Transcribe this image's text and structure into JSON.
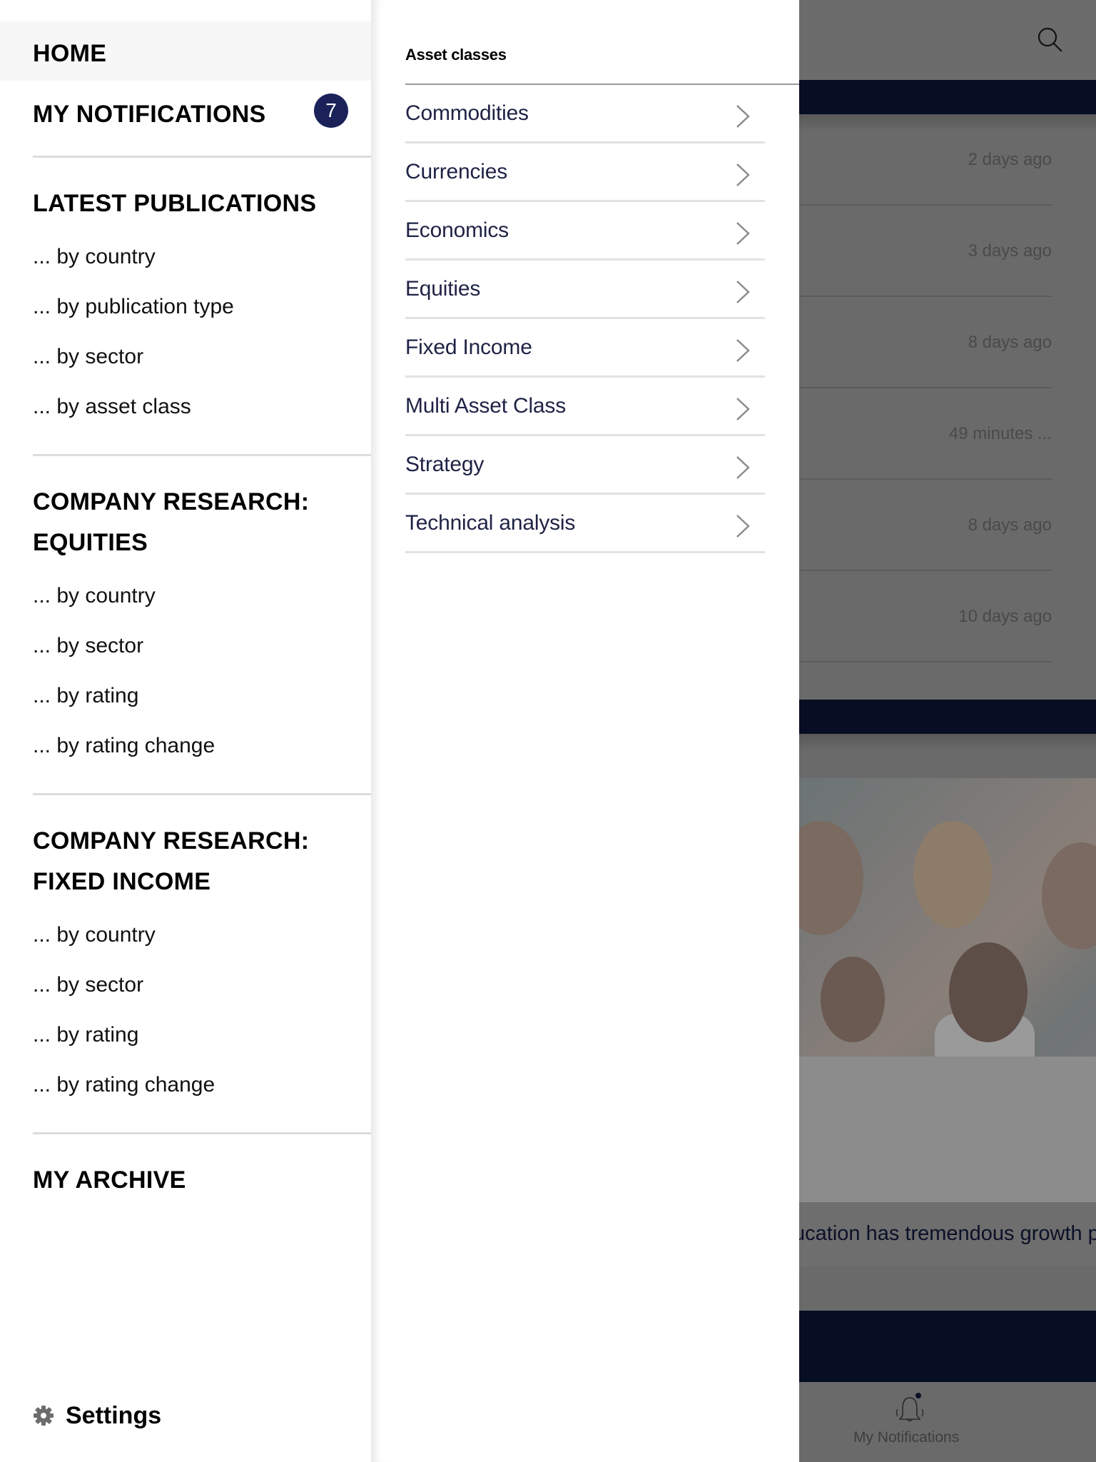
{
  "left_menu": {
    "home": "HOME",
    "notifications": {
      "label": "MY NOTIFICATIONS",
      "count": "7"
    },
    "sections": [
      {
        "title_lines": [
          "LATEST PUBLICATIONS"
        ],
        "items": [
          "... by country",
          "... by publication type",
          "... by sector",
          "... by asset class"
        ]
      },
      {
        "title_lines": [
          "COMPANY RESEARCH:",
          "EQUITIES"
        ],
        "items": [
          "... by country",
          "... by sector",
          "... by rating",
          "... by rating change"
        ]
      },
      {
        "title_lines": [
          "COMPANY RESEARCH:",
          "FIXED INCOME"
        ],
        "items": [
          "... by country",
          "... by sector",
          "... by rating",
          "... by rating change"
        ]
      }
    ],
    "archive": "MY ARCHIVE",
    "settings": "Settings"
  },
  "submenu": {
    "title": "Asset classes",
    "items": [
      "Commodities",
      "Currencies",
      "Economics",
      "Equities",
      "Fixed Income",
      "Multi Asset Class",
      "Strategy",
      "Technical analysis"
    ]
  },
  "background": {
    "timestamps": [
      "2 days ago",
      "3 days ago",
      "8 days ago",
      "49 minutes ...",
      "8 days ago",
      "10 days ago"
    ],
    "caption": "ucation has tremendous growth pot",
    "bottom_nav_label": "My Notifications"
  },
  "colors": {
    "badge": "#1b2259",
    "nav_band": "#070d22",
    "overlay": "#6a6a6a",
    "submenu_text": "#1e2345"
  }
}
